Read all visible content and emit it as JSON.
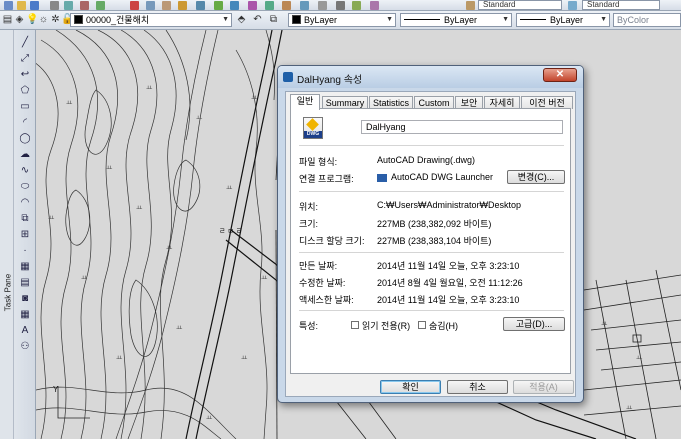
{
  "toolbar": {
    "layer_name": "00000_건물해치",
    "color": "ByLayer",
    "linetype": "ByLayer",
    "lineweight": "ByLayer",
    "plotstyle": "ByColor",
    "style1": "Standard",
    "style2": "Standard"
  },
  "sidebar": {
    "taskpane_label": "Task Pane"
  },
  "drawing": {
    "text_label": "ㄹ ㅁ ㄹ",
    "ucs_y": "Y"
  },
  "dialog": {
    "title": "DalHyang 속성",
    "close_label": "✕",
    "tabs": [
      "일반",
      "Summary",
      "Statistics",
      "Custom",
      "보안",
      "자세히",
      "이전 버전"
    ],
    "file_name": "DalHyang",
    "file_icon_text": "DWG",
    "file_type_label": "파일 형식:",
    "file_type_value": "AutoCAD Drawing(.dwg)",
    "opens_with_label": "연결 프로그램:",
    "opens_with_value": "AutoCAD DWG Launcher",
    "change_button": "변경(C)...",
    "location_label": "위치:",
    "location_value": "C:₩Users₩Administrator₩Desktop",
    "size_label": "크기:",
    "size_value": "227MB (238,382,092 바이트)",
    "size_on_disk_label": "디스크 할당 크기:",
    "size_on_disk_value": "227MB (238,383,104 바이트)",
    "created_label": "만든 날짜:",
    "created_value": "2014년 11월 14일 오늘, 오후 3:23:10",
    "modified_label": "수정한 날짜:",
    "modified_value": "2014년 8월 4일 월요일, 오전 11:12:26",
    "accessed_label": "액세스한 날짜:",
    "accessed_value": "2014년 11월 14일 오늘, 오후 3:23:10",
    "attributes_label": "특성:",
    "readonly_label": "읽기 전용(R)",
    "hidden_label": "숨김(H)",
    "advanced_button": "고급(D)...",
    "ok_button": "확인",
    "cancel_button": "취소",
    "apply_button": "적용(A)"
  }
}
